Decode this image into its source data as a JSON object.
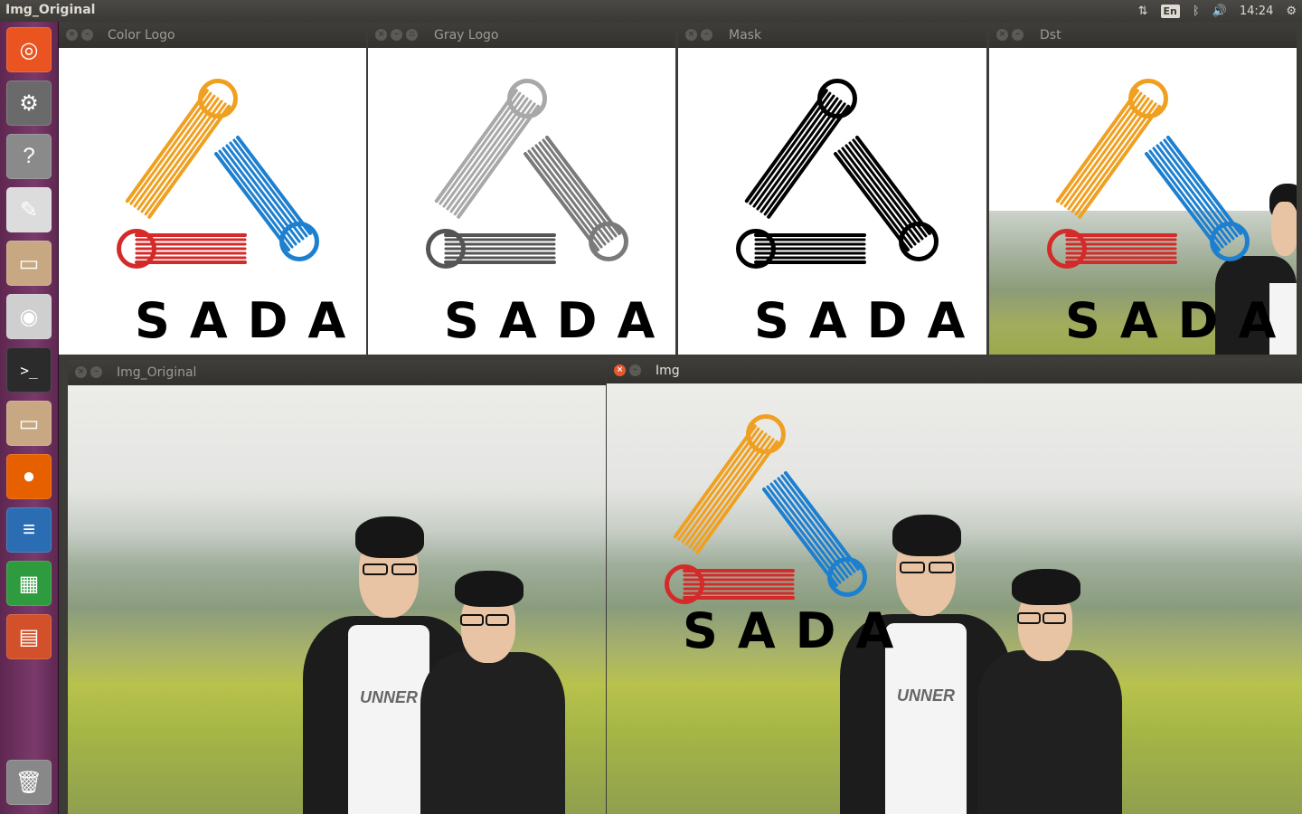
{
  "topbar": {
    "title": "Img_Original",
    "lang": "En",
    "time": "14:24"
  },
  "launcher": [
    {
      "name": "ubuntu-dash-icon",
      "glyph": "◎",
      "bg": "#e95420"
    },
    {
      "name": "system-settings-icon",
      "glyph": "⚙",
      "bg": "#6a6a6a"
    },
    {
      "name": "help-icon",
      "glyph": "?",
      "bg": "#8a8a8a"
    },
    {
      "name": "text-editor-icon",
      "glyph": "✎",
      "bg": "#dcdcdc"
    },
    {
      "name": "files-icon",
      "glyph": "▭",
      "bg": "#c7a882"
    },
    {
      "name": "camera-icon",
      "glyph": "◉",
      "bg": "#cfcfcf"
    },
    {
      "name": "terminal-icon",
      "glyph": ">_",
      "bg": "#2b2b2b"
    },
    {
      "name": "files-icon",
      "glyph": "▭",
      "bg": "#c7a882"
    },
    {
      "name": "firefox-icon",
      "glyph": "●",
      "bg": "#e66000"
    },
    {
      "name": "writer-icon",
      "glyph": "≡",
      "bg": "#2a6db3"
    },
    {
      "name": "calc-icon",
      "glyph": "▦",
      "bg": "#2e9b3f"
    },
    {
      "name": "impress-icon",
      "glyph": "▤",
      "bg": "#d2502a"
    },
    {
      "name": "trash-icon",
      "glyph": "🗑",
      "bg": "#888888"
    }
  ],
  "windows": {
    "color_logo": {
      "title": "Color Logo",
      "logo_text": "SADA"
    },
    "gray_logo": {
      "title": "Gray Logo",
      "logo_text": "SADA"
    },
    "mask": {
      "title": "Mask",
      "logo_text": "SADA"
    },
    "dst": {
      "title": "Dst",
      "logo_text": "SADA"
    },
    "img_original": {
      "title": "Img_Original",
      "shirt_text": "UNNER"
    },
    "img": {
      "title": "Img",
      "logo_text": "SADA",
      "shirt_text": "UNNER"
    }
  },
  "colors": {
    "orange": "#f0a020",
    "blue": "#1c7fd0",
    "red": "#d42a2a",
    "gray_light": "#a8a8a8",
    "gray_mid": "#7a7a7a",
    "gray_dark": "#555555",
    "black": "#000000",
    "accent_close": "#e6592e",
    "launcher": "#5e2750"
  }
}
